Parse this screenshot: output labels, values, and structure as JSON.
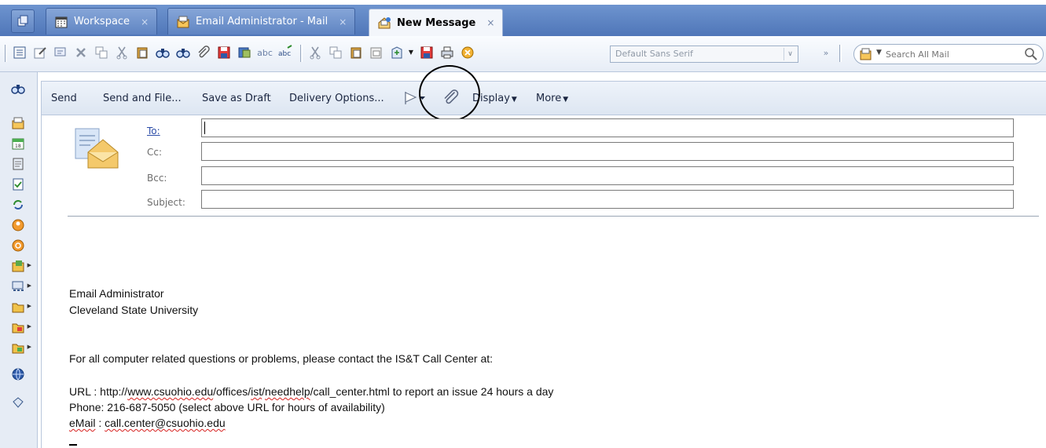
{
  "tabs": [
    {
      "label": "Workspace",
      "icon": "calendar-grid-icon",
      "close": "×"
    },
    {
      "label": "Email Administrator - Mail",
      "icon": "mailbox-icon",
      "close": "×"
    },
    {
      "label": "New Message",
      "icon": "new-message-icon",
      "close": "×",
      "active": true
    }
  ],
  "toolbar": {
    "font_name": "Default Sans Serif",
    "search_placeholder": "Search All Mail"
  },
  "actions": {
    "send": "Send",
    "send_and_file": "Send and File...",
    "save_as_draft": "Save as Draft",
    "delivery_options": "Delivery Options...",
    "display": "Display",
    "more": "More"
  },
  "fields": {
    "to_label": "To:",
    "cc_label": "Cc:",
    "bcc_label": "Bcc:",
    "subject_label": "Subject:",
    "to_value": "",
    "cc_value": "",
    "bcc_value": "",
    "subject_value": ""
  },
  "body": {
    "line1": "Email Administrator",
    "line2": "Cleveland State University",
    "line3": "For all computer related questions or problems, please contact the IS&T Call Center at:",
    "url_label": "URL",
    "url_prefix": "  : http://",
    "url_host": "www.csuohio.edu",
    "url_path1": "/offices/",
    "url_ist": "ist",
    "url_slash": "/",
    "url_needhelp": "needhelp",
    "url_rest": "/call_center.html to report an issue 24 hours a day",
    "phone": "Phone: 216-687-5050 (select above URL for hours of availability)",
    "email_label": "eMail",
    "email_sep": " : ",
    "email_value": "call.center@csuohio.edu"
  },
  "colors": {
    "tab_bar": "#5f84c2",
    "active_tab": "#f3f6fb",
    "link": "#2c4da8",
    "spellcheck": "#d6201e"
  }
}
